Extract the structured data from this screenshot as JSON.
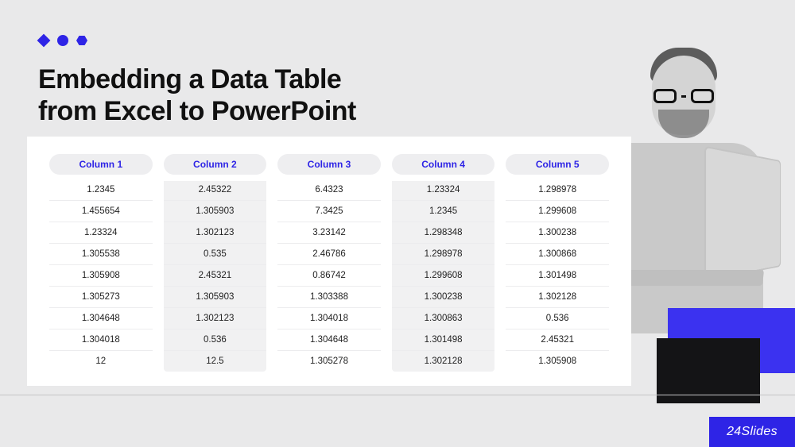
{
  "title_line1": "Embedding a Data Table",
  "title_line2": "from Excel to PowerPoint",
  "brand": "24Slides",
  "columns": [
    {
      "header": "Column 1",
      "shaded": false,
      "cells": [
        "1.2345",
        "1.455654",
        "1.23324",
        "1.305538",
        "1.305908",
        "1.305273",
        "1.304648",
        "1.304018",
        "12"
      ]
    },
    {
      "header": "Column 2",
      "shaded": true,
      "cells": [
        "2.45322",
        "1.305903",
        "1.302123",
        "0.535",
        "2.45321",
        "1.305903",
        "1.302123",
        "0.536",
        "12.5"
      ]
    },
    {
      "header": "Column 3",
      "shaded": false,
      "cells": [
        "6.4323",
        "7.3425",
        "3.23142",
        "2.46786",
        "0.86742",
        "1.303388",
        "1.304018",
        "1.304648",
        "1.305278"
      ]
    },
    {
      "header": "Column 4",
      "shaded": true,
      "cells": [
        "1.23324",
        "1.2345",
        "1.298348",
        "1.298978",
        "1.299608",
        "1.300238",
        "1.300863",
        "1.301498",
        "1.302128"
      ]
    },
    {
      "header": "Column 5",
      "shaded": false,
      "cells": [
        "1.298978",
        "1.299608",
        "1.300238",
        "1.300868",
        "1.301498",
        "1.302128",
        "0.536",
        "2.45321",
        "1.305908"
      ]
    }
  ],
  "chart_data": {
    "type": "table",
    "title": "Embedding a Data Table from Excel to PowerPoint",
    "columns": [
      "Column 1",
      "Column 2",
      "Column 3",
      "Column 4",
      "Column 5"
    ],
    "rows": [
      [
        1.2345,
        2.45322,
        6.4323,
        1.23324,
        1.298978
      ],
      [
        1.455654,
        1.305903,
        7.3425,
        1.2345,
        1.299608
      ],
      [
        1.23324,
        1.302123,
        3.23142,
        1.298348,
        1.300238
      ],
      [
        1.305538,
        0.535,
        2.46786,
        1.298978,
        1.300868
      ],
      [
        1.305908,
        2.45321,
        0.86742,
        1.299608,
        1.301498
      ],
      [
        1.305273,
        1.305903,
        1.303388,
        1.300238,
        1.302128
      ],
      [
        1.304648,
        1.302123,
        1.304018,
        1.300863,
        0.536
      ],
      [
        1.304018,
        0.536,
        1.304648,
        1.301498,
        2.45321
      ],
      [
        12,
        12.5,
        1.305278,
        1.302128,
        1.305908
      ]
    ]
  }
}
